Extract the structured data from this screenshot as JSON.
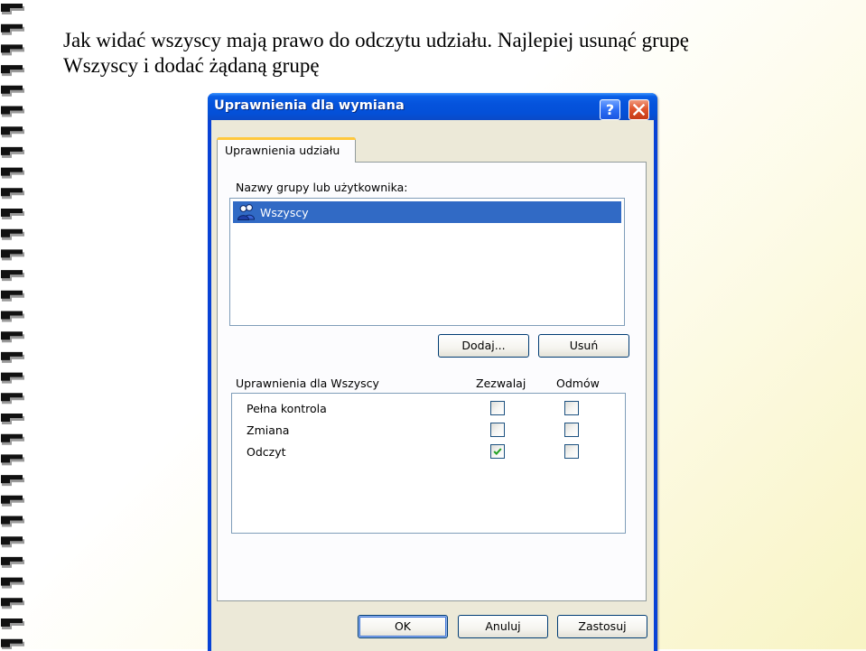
{
  "slide": {
    "line1": "Jak widać wszyscy mają prawo do odczytu udziału. Najlepiej usunąć grupę",
    "line2": "Wszyscy i dodać żądaną grupę"
  },
  "dialog": {
    "title": "Uprawnienia dla wymiana",
    "help_label": "?",
    "tab_label": "Uprawnienia udziału",
    "groups_label": "Nazwy grupy lub użytkownika:",
    "groups": [
      {
        "label": "Wszyscy",
        "icon": "group-icon",
        "selected": true
      }
    ],
    "add_label": "Dodaj...",
    "remove_label": "Usuń",
    "permissions_header": "Uprawnienia dla Wszyscy",
    "allow_header": "Zezwalaj",
    "deny_header": "Odmów",
    "permissions": [
      {
        "name": "Pełna kontrola",
        "allow": false,
        "deny": false
      },
      {
        "name": "Zmiana",
        "allow": false,
        "deny": false
      },
      {
        "name": "Odczyt",
        "allow": true,
        "deny": false
      }
    ],
    "ok_label": "OK",
    "cancel_label": "Anuluj",
    "apply_label": "Zastosuj"
  },
  "colors": {
    "titlebar": "#0553dc",
    "selection": "#316ac5",
    "tab_accent": "#ffc83c",
    "checkmark": "#21a121",
    "dialog_face": "#ece9d8"
  }
}
